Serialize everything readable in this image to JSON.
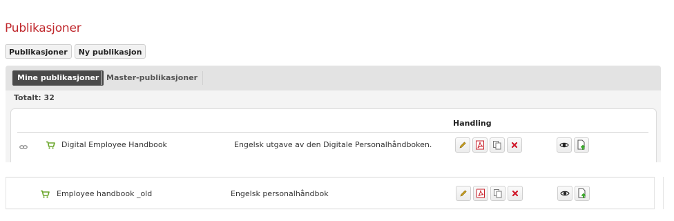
{
  "page": {
    "title": "Publikasjoner"
  },
  "toolbar": {
    "publications_label": "Publikasjoner",
    "new_publication_label": "Ny publikasjon"
  },
  "tabs": {
    "mine_label": "Mine publikasjoner",
    "master_label": "Master-publikasjoner"
  },
  "list": {
    "total_label": "Totalt: 32",
    "column_handling": "Handling",
    "rows": [
      {
        "name": "Digital Employee Handbook",
        "description": "Engelsk utgave av den Digitale Personalhåndboken.",
        "linked": true
      },
      {
        "name": "Employee handbook _old",
        "description": "Engelsk personalhåndbok",
        "linked": false
      }
    ]
  },
  "icons": {
    "link": "link-icon",
    "cart": "cart-icon",
    "edit": "pencil-icon",
    "pdf": "pdf-icon",
    "copy": "copy-icon",
    "delete": "delete-icon",
    "view": "eye-icon",
    "export": "document-export-icon"
  },
  "colors": {
    "title": "#c0282d",
    "active_tab": "#4a4a4a",
    "cart": "#6aa62a",
    "delete": "#d0182a",
    "pdf": "#c8202a"
  }
}
